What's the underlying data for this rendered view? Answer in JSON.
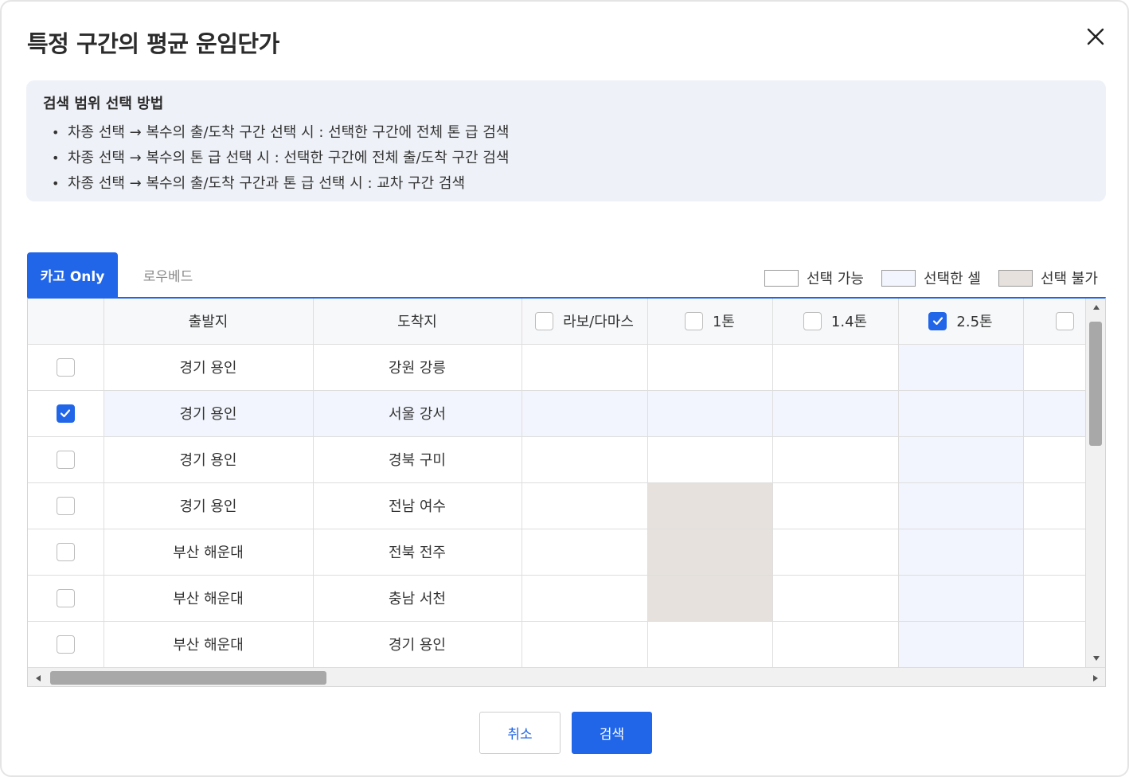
{
  "dialog": {
    "title": "특정 구간의 평균 운임단가",
    "close_icon": "close-icon"
  },
  "info": {
    "title": "검색 범위 선택 방법",
    "items": [
      "차종 선택 → 복수의 출/도착 구간 선택 시 : 선택한 구간에 전체 톤 급 검색",
      "차종 선택 → 복수의 톤 급 선택 시 : 선택한 구간에 전체 출/도착 구간 검색",
      "차종 선택 → 복수의 출/도착 구간과 톤 급 선택 시 : 교차 구간 검색"
    ]
  },
  "tabs": [
    {
      "label": "카고 Only",
      "active": true
    },
    {
      "label": "로우베드",
      "active": false
    }
  ],
  "legend": [
    {
      "label": "선택 가능",
      "color": "#ffffff"
    },
    {
      "label": "선택한 셀",
      "color": "#f2f5fd"
    },
    {
      "label": "선택 불가",
      "color": "#e6e1dd"
    }
  ],
  "grid": {
    "columns": {
      "origin": "출발지",
      "destination": "도착지",
      "tonnage": [
        {
          "label": "라보/다마스",
          "checked": false
        },
        {
          "label": "1톤",
          "checked": false
        },
        {
          "label": "1.4톤",
          "checked": false
        },
        {
          "label": "2.5톤",
          "checked": true
        },
        {
          "label": "",
          "checked": false
        }
      ]
    },
    "rows": [
      {
        "origin": "경기 용인",
        "destination": "강원 강릉",
        "checked": false
      },
      {
        "origin": "경기 용인",
        "destination": "서울 강서",
        "checked": true
      },
      {
        "origin": "경기 용인",
        "destination": "경북 구미",
        "checked": false
      },
      {
        "origin": "경기 용인",
        "destination": "전남 여수",
        "checked": false
      },
      {
        "origin": "부산 해운대",
        "destination": "전북 전주",
        "checked": false
      },
      {
        "origin": "부산 해운대",
        "destination": "충남 서천",
        "checked": false
      },
      {
        "origin": "부산 해운대",
        "destination": "경기 용인",
        "checked": false
      }
    ]
  },
  "colors": {
    "accent": "#2166e8",
    "selected_cell": "#f2f5fd",
    "disabled_cell": "#e6e1dd",
    "info_bg": "#eef1f7"
  },
  "buttons": {
    "cancel": "취소",
    "search": "검색"
  }
}
